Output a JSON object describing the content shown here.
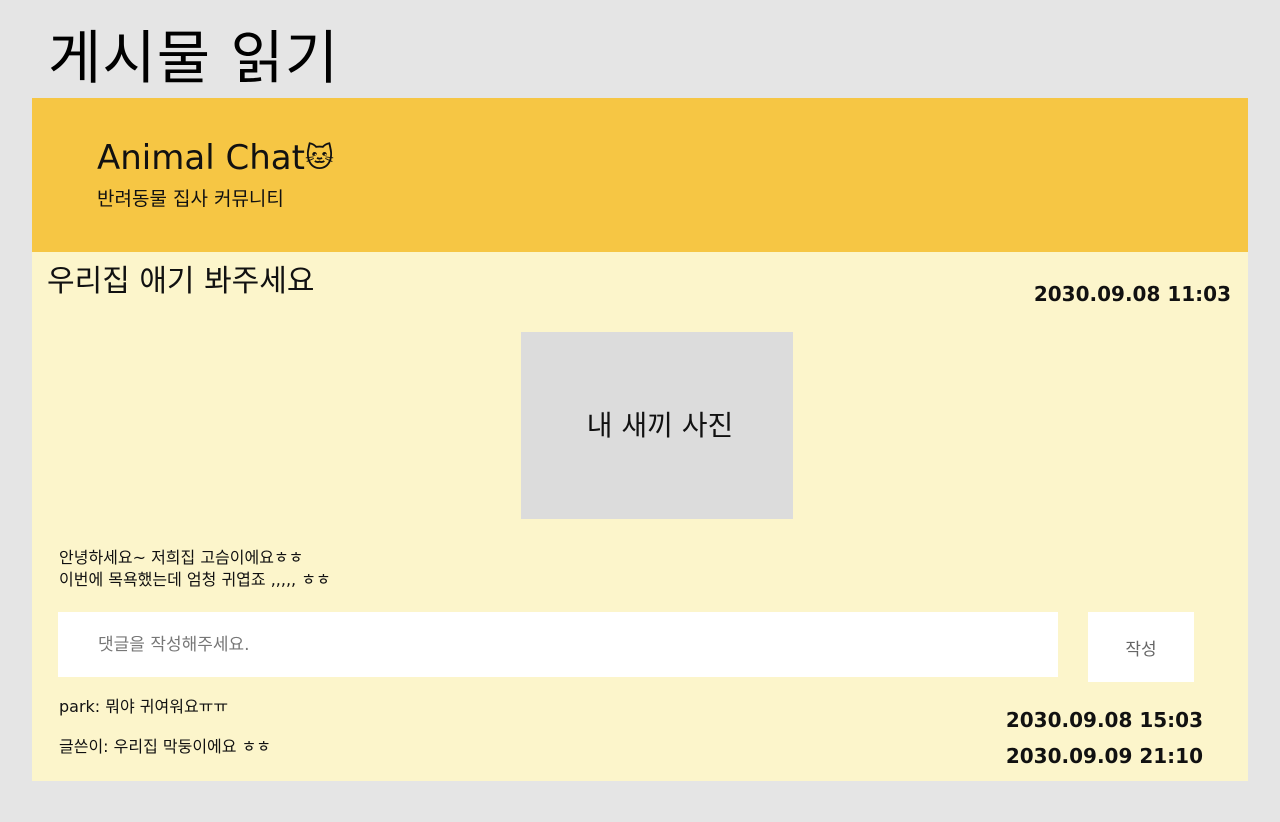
{
  "page": {
    "heading": "게시물 읽기"
  },
  "banner": {
    "title": "Animal Chat",
    "icon": "cat-face-icon",
    "icon_glyph": "🐱",
    "subtitle": "반려동물 집사 커뮤니티",
    "color": "#f6c644"
  },
  "post": {
    "title": "우리집 애기 봐주세요",
    "date": "2030.09.08 11:03",
    "photo_label": "내 새끼 사진",
    "body_lines": [
      "안녕하세요~ 저희집 고슴이에요ㅎㅎ",
      "이번에 목욕했는데 엄청 귀엽죠 ,,,,, ㅎㅎ"
    ],
    "background": "#fcf5cb"
  },
  "comment_form": {
    "placeholder": "댓글을 작성해주세요.",
    "value": "",
    "submit_label": "작성"
  },
  "comments": [
    {
      "text": "park: 뭐야 귀여워요ㅠㅠ",
      "date": "2030.09.08 15:03"
    },
    {
      "text": "글쓴이: 우리집 막둥이에요 ㅎㅎ",
      "date": "2030.09.09 21:10"
    }
  ]
}
